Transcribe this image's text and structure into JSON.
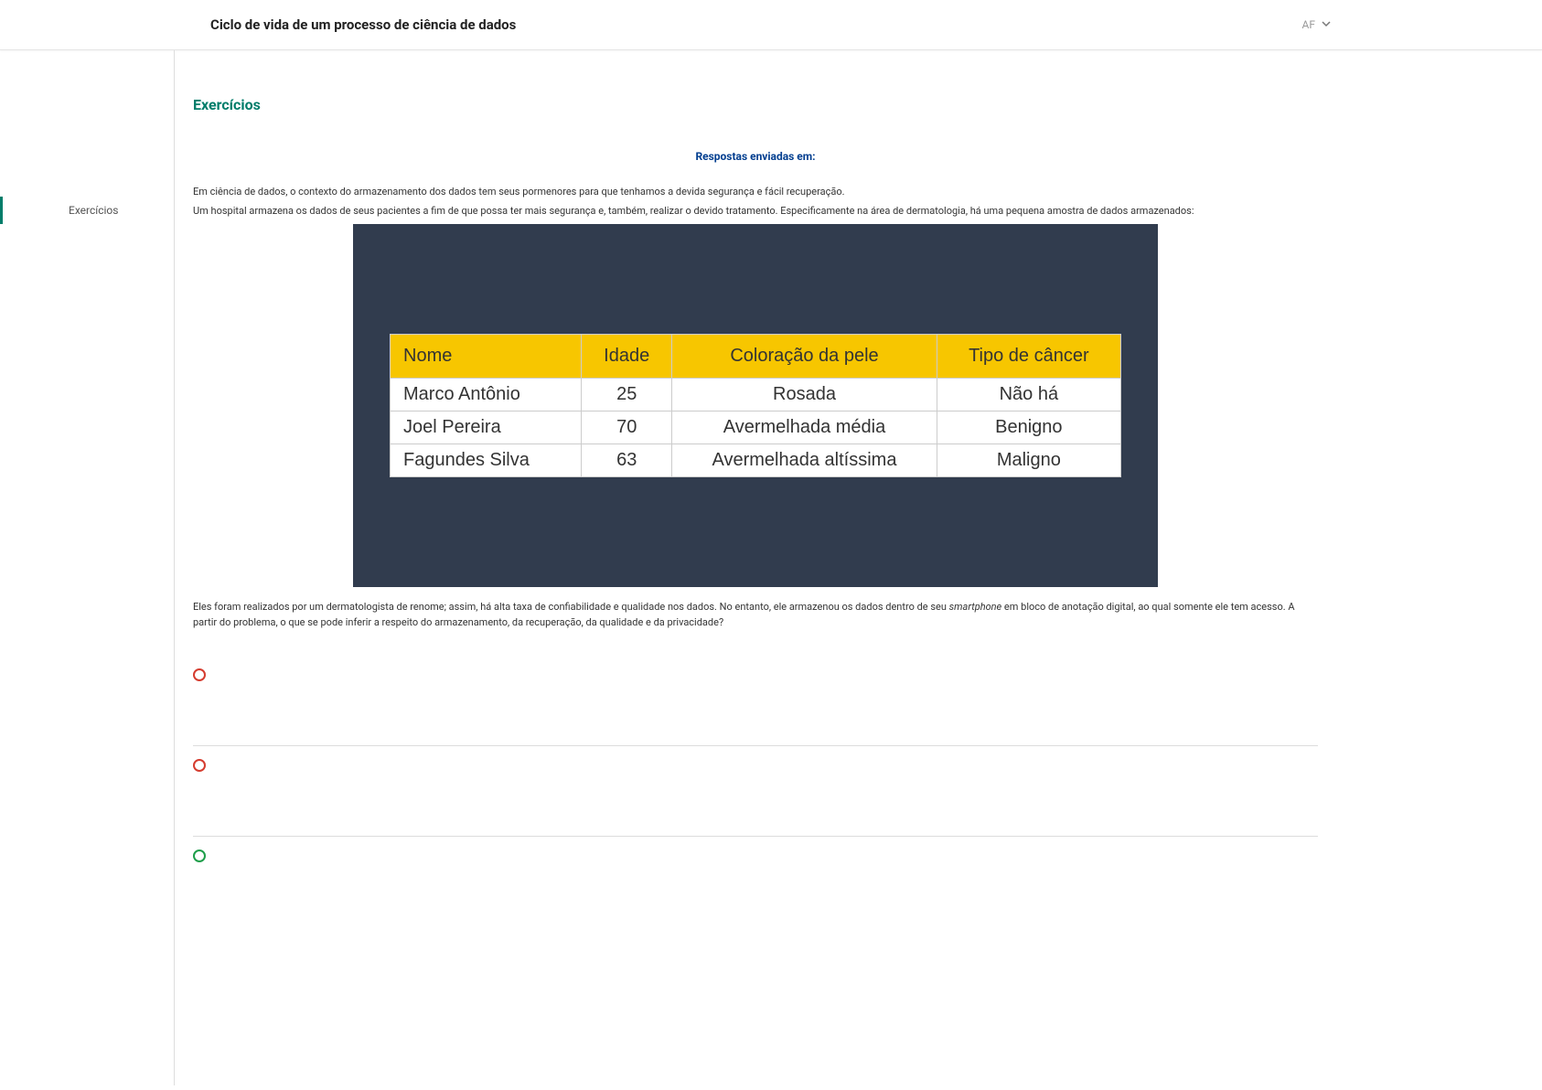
{
  "header": {
    "title": "Ciclo de vida de um processo de ciência de dados",
    "user_initials": "AF"
  },
  "sidebar": {
    "items": [
      {
        "label": "Exercícios"
      }
    ]
  },
  "main": {
    "section_title": "Exercícios",
    "submitted_label": "Respostas enviadas em:",
    "intro_line1": "Em ciência de dados, o contexto do armazenamento dos dados tem seus pormenores para que tenhamos a devida segurança e fácil recuperação.",
    "intro_line2": "Um hospital armazena os dados de seus pacientes a fim de que possa ter mais segurança e, também, realizar o devido tratamento. Especificamente na área de dermatologia, há uma pequena amostra de dados armazenados:",
    "table": {
      "headers": [
        "Nome",
        "Idade",
        "Coloração da pele",
        "Tipo de câncer"
      ],
      "rows": [
        [
          "Marco Antônio",
          "25",
          "Rosada",
          "Não há"
        ],
        [
          "Joel Pereira",
          "70",
          "Avermelhada média",
          "Benigno"
        ],
        [
          "Fagundes Silva",
          "63",
          "Avermelhada altíssima",
          "Maligno"
        ]
      ]
    },
    "question_pre": "Eles foram realizados por um dermatologista de renome; assim, há alta taxa de confiabilidade e qualidade nos dados. No entanto, ele armazenou os dados dentro de seu ",
    "question_italic": "smartphone",
    "question_post": " em bloco de anotação digital, ao qual somente ele tem acesso. A partir do problema, o que se pode inferir a respeito do armazenamento, da recuperação, da qualidade e da privacidade?",
    "options": [
      {
        "color": "red",
        "text": ""
      },
      {
        "color": "red",
        "text": ""
      },
      {
        "color": "green",
        "text": ""
      }
    ]
  }
}
